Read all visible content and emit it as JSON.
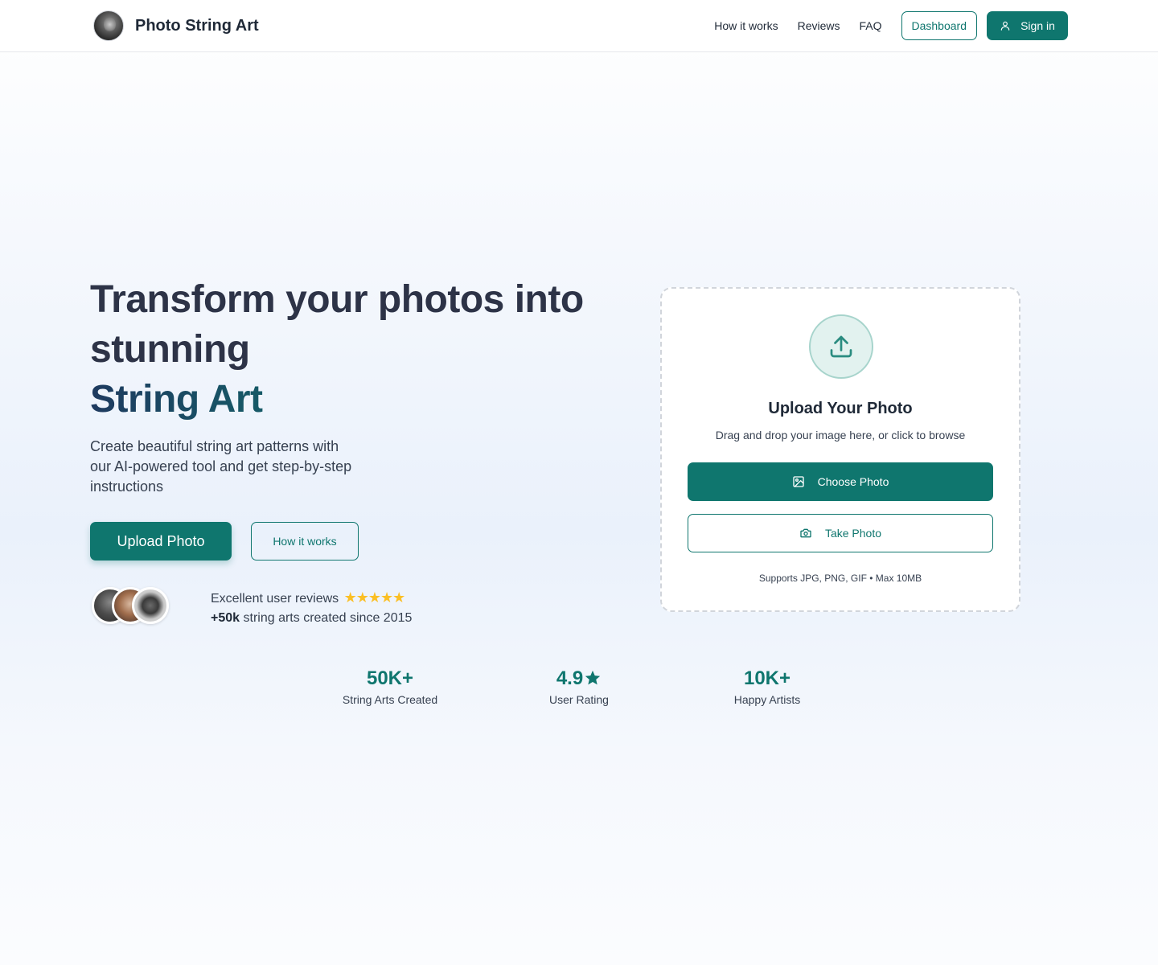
{
  "header": {
    "brand": "Photo String Art",
    "nav": [
      "How it works",
      "Reviews",
      "FAQ"
    ],
    "dashboard_label": "Dashboard",
    "signin_label": "Sign in"
  },
  "hero": {
    "title_line1": "Transform your photos into stunning",
    "title_accent": "String Art",
    "subtitle": "Create beautiful string art patterns with our AI-powered tool and get step-by-step instructions",
    "upload_button": "Upload Photo",
    "how_button": "How it works",
    "reviews_text": "Excellent user reviews",
    "stars": "★★★★★",
    "count_bold": "+50k",
    "count_text": "string arts created since 2015"
  },
  "upload_card": {
    "title": "Upload Your Photo",
    "subtitle": "Drag and drop your image here, or click to browse",
    "choose_label": "Choose Photo",
    "take_label": "Take Photo",
    "note": "Supports JPG, PNG, GIF • Max 10MB"
  },
  "stats": [
    {
      "value": "50K+",
      "label": "String Arts Created"
    },
    {
      "value": "4.9",
      "label": "User Rating"
    },
    {
      "value": "10K+",
      "label": "Happy Artists"
    }
  ],
  "colors": {
    "primary": "#0f766e",
    "star": "#fbbf24",
    "heading": "#2d3347"
  },
  "icons": [
    "user-icon",
    "upload-icon",
    "image-icon",
    "camera-icon",
    "star-icon"
  ]
}
